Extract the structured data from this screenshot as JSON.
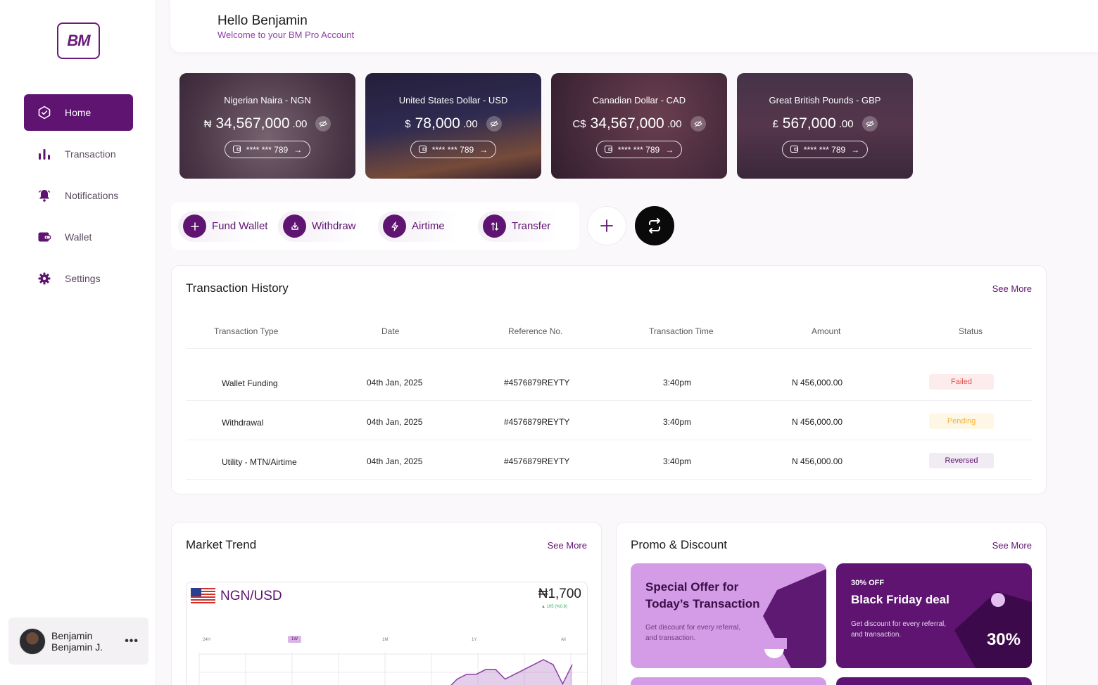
{
  "brand": {
    "logo_text": "BM"
  },
  "sidebar": {
    "items": [
      {
        "label": "Home",
        "icon": "home-icon",
        "active": true
      },
      {
        "label": "Transaction",
        "icon": "bar-chart-icon"
      },
      {
        "label": "Notifications",
        "icon": "bell-icon"
      },
      {
        "label": "Wallet",
        "icon": "wallet-icon"
      },
      {
        "label": "Settings",
        "icon": "gear-icon"
      }
    ],
    "user": {
      "first_name": "Benjamin",
      "short_name": "Benjamin J.",
      "more": "•••"
    }
  },
  "header": {
    "greeting": "Hello Benjamin",
    "subtitle": "Welcome to your BM Pro Account"
  },
  "currency_cards": [
    {
      "name": "Nigerian Naira - NGN",
      "symbol": "₦",
      "amount": "34,567,000",
      "decimals": ".00",
      "account": "**** *** 789"
    },
    {
      "name": "United States Dollar - USD",
      "symbol": "$",
      "amount": "78,000",
      "decimals": ".00",
      "account": "**** *** 789"
    },
    {
      "name": "Canadian Dollar - CAD",
      "symbol": "C$",
      "amount": "34,567,000",
      "decimals": ".00",
      "account": "**** *** 789"
    },
    {
      "name": "Great British Pounds - GBP",
      "symbol": "£",
      "amount": "567,000",
      "decimals": ".00",
      "account": "**** *** 789"
    }
  ],
  "quick_actions": [
    {
      "label": "Fund Wallet",
      "icon": "plus-icon"
    },
    {
      "label": "Withdraw",
      "icon": "download-icon"
    },
    {
      "label": "Airtime",
      "icon": "lightning-icon"
    },
    {
      "label": "Transfer",
      "icon": "arrows-updown-icon"
    }
  ],
  "transactions": {
    "title": "Transaction History",
    "see_more": "See More",
    "columns": [
      "Transaction Type",
      "Date",
      "Reference No.",
      "Transaction Time",
      "Amount",
      "Status"
    ],
    "rows": [
      {
        "type": "Wallet Funding",
        "date": "04th Jan, 2025",
        "ref": "#4576879REYTY",
        "time": "3:40pm",
        "amount": "N 456,000.00",
        "status": "Failed"
      },
      {
        "type": "Withdrawal",
        "date": "04th Jan, 2025",
        "ref": "#4576879REYTY",
        "time": "3:40pm",
        "amount": "N 456,000.00",
        "status": "Pending"
      },
      {
        "type": "Utility - MTN/Airtime",
        "date": "04th Jan, 2025",
        "ref": "#4576879REYTY",
        "time": "3:40pm",
        "amount": "N 456,000.00",
        "status": "Reversed"
      }
    ]
  },
  "market": {
    "title": "Market Trend",
    "see_more": "See More",
    "pair": "NGN/USD",
    "rate": "₦1,700",
    "change": "▲ 105 (%0.8)",
    "periods": [
      "24H",
      "1W",
      "1M",
      "1Y",
      "All"
    ],
    "selected_period": "1W"
  },
  "promo": {
    "title": "Promo & Discount",
    "see_more": "See More",
    "cards": [
      {
        "title": "Special Offer for Today’s Transaction",
        "desc": "Get discount for every referral, and transaction."
      },
      {
        "tag": "30% OFF",
        "title": "Black Friday deal",
        "desc": "Get discount for every referral, and transaction.",
        "percent": "30%"
      }
    ]
  },
  "colors": {
    "primary": "#5e1470",
    "accent": "#8e3ea6",
    "failed": "#e0544d",
    "pending": "#f2b23a"
  },
  "chart_data": {
    "type": "area",
    "series": [
      {
        "values": [
          0,
          1,
          2,
          3,
          5,
          6,
          6,
          7,
          7,
          5,
          6,
          7,
          8,
          9,
          8,
          4,
          8
        ]
      }
    ]
  }
}
